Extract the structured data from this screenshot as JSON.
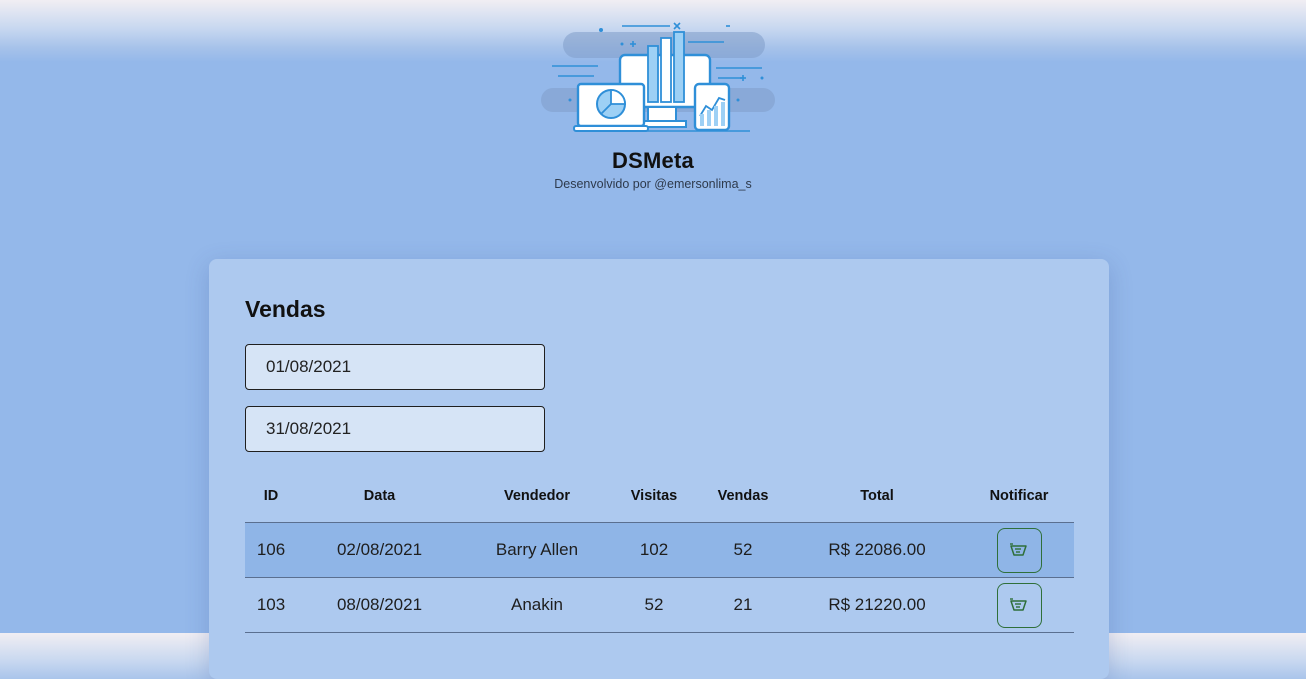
{
  "header": {
    "title": "DSMeta",
    "subtitle": "Desenvolvido por @emersonlima_s",
    "logo_icon": "analytics-dashboard-illustration"
  },
  "sales": {
    "title": "Vendas",
    "start_date": "01/08/2021",
    "end_date": "31/08/2021",
    "columns": [
      "ID",
      "Data",
      "Vendedor",
      "Visitas",
      "Vendas",
      "Total",
      "Notificar"
    ],
    "rows": [
      {
        "id": "106",
        "date": "02/08/2021",
        "seller": "Barry Allen",
        "visits": "102",
        "deals": "52",
        "total": "R$ 22086.00",
        "notify_icon": "send-notification-icon"
      },
      {
        "id": "103",
        "date": "08/08/2021",
        "seller": "Anakin",
        "visits": "52",
        "deals": "21",
        "total": "R$ 21220.00",
        "notify_icon": "send-notification-icon"
      }
    ]
  },
  "colors": {
    "background": "#94b8ea",
    "card": "#adc9ef",
    "highlight_row": "#8fb5e7",
    "input_bg": "#d6e4f6",
    "notify_green": "#2f6f3a",
    "logo_blue": "#2f8fd8"
  }
}
